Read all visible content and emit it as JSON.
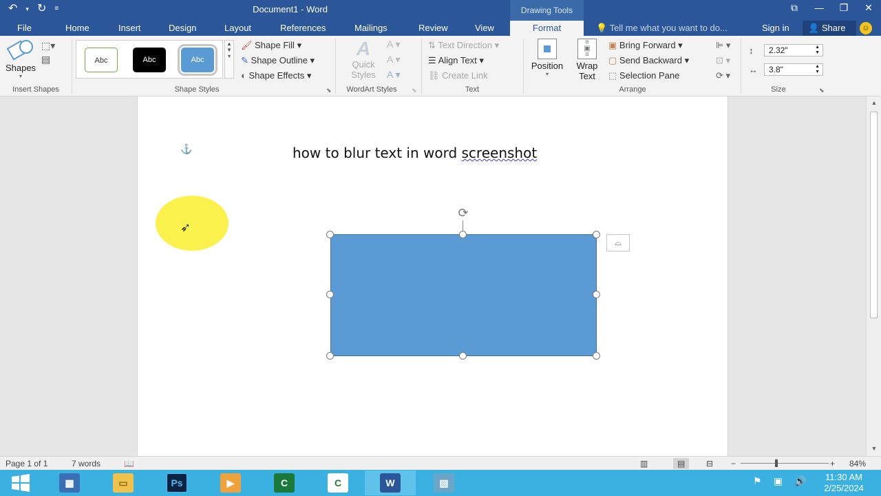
{
  "titlebar": {
    "document_title": "Document1 - Word",
    "contextual_group": "Drawing Tools",
    "undo_icon": "undo-icon",
    "redo_icon": "redo-icon"
  },
  "tabs": [
    "File",
    "Home",
    "Insert",
    "Design",
    "Layout",
    "References",
    "Mailings",
    "Review",
    "View",
    "Format"
  ],
  "active_tab": "Format",
  "tell_me_placeholder": "Tell me what you want to do...",
  "sign_in": "Sign in",
  "share": "Share",
  "ribbon": {
    "insert_shapes": {
      "shapes_label": "Shapes",
      "group": "Insert Shapes"
    },
    "shape_styles": {
      "group": "Shape Styles",
      "styles": [
        "Abc",
        "Abc",
        "Abc"
      ],
      "shape_fill": "Shape Fill",
      "shape_outline": "Shape Outline",
      "shape_effects": "Shape Effects"
    },
    "wordart_styles": {
      "group": "WordArt Styles",
      "quick_styles_line1": "Quick",
      "quick_styles_line2": "Styles"
    },
    "text": {
      "group": "Text",
      "text_direction": "Text Direction",
      "align_text": "Align Text",
      "create_link": "Create Link"
    },
    "arrange": {
      "group": "Arrange",
      "position": "Position",
      "wrap_text_line1": "Wrap",
      "wrap_text_line2": "Text",
      "bring_forward": "Bring Forward",
      "send_backward": "Send Backward",
      "selection_pane": "Selection Pane"
    },
    "size": {
      "group": "Size",
      "height": "2.32\"",
      "width": "3.8\""
    }
  },
  "document": {
    "heading_part1": "how to blur text in word ",
    "heading_part2": "screenshot"
  },
  "statusbar": {
    "page": "Page 1 of 1",
    "words": "7 words",
    "zoom": "84%"
  },
  "taskbar": {
    "apps": [
      "start",
      "server-manager",
      "file-explorer",
      "photoshop",
      "media-player",
      "camtasia",
      "camtasia-recorder",
      "word",
      "screenshot-tool"
    ],
    "clock_time": "11:30 AM",
    "clock_date": "2/25/2024"
  },
  "colors": {
    "word_blue": "#2b579a",
    "shape_fill": "#5b9bd5",
    "taskbar": "#3ab1e0",
    "cursor_highlight": "#fbf24e"
  }
}
